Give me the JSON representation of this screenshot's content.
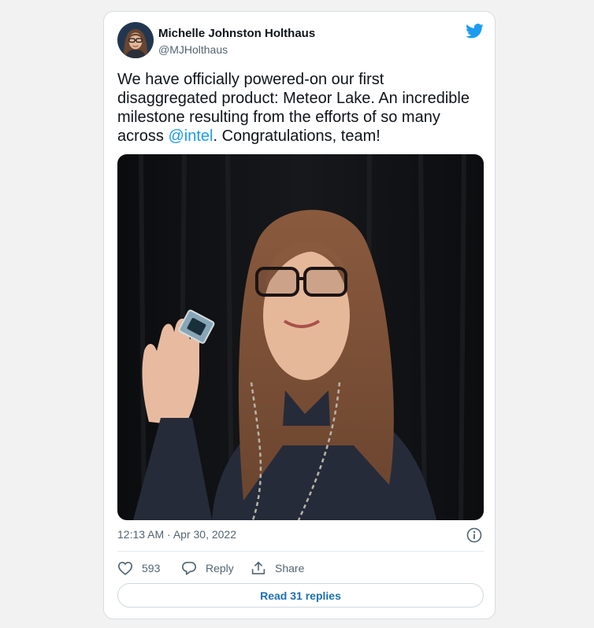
{
  "tweet": {
    "author_name": "Michelle Johnston Holthaus",
    "author_handle": "@MJHolthaus",
    "text_part1": "We have officially powered-on our first disaggregated product: Meteor Lake. An incredible milestone resulting from the efforts of so many across ",
    "mention": "@intel",
    "text_part2": ". Congratulations, team!",
    "time": "12:13 AM",
    "separator": " · ",
    "date": "Apr 30, 2022"
  },
  "actions": {
    "like_count": "593",
    "reply_label": "Reply",
    "share_label": "Share",
    "read_replies_label": "Read 31 replies"
  },
  "icons": {
    "brand": "twitter-bird-icon",
    "info": "info-icon",
    "like": "heart-icon",
    "reply": "speech-bubble-icon",
    "share": "share-arrow-icon"
  },
  "colors": {
    "link": "#1d9bf0",
    "twitter_blue": "#1d9bf0",
    "secondary_text": "#536471",
    "button_text": "#1b6fb5"
  }
}
